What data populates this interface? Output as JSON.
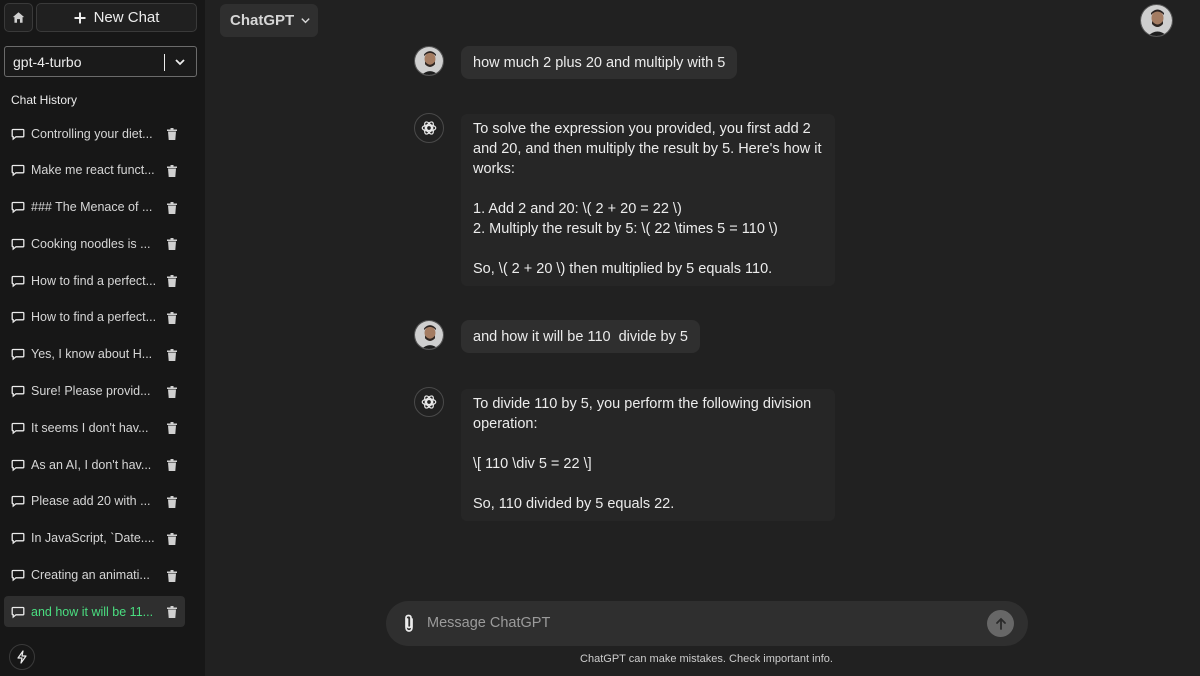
{
  "sidebar": {
    "new_chat_label": "New Chat",
    "model_select_value": "gpt-4-turbo",
    "history_title": "Chat History",
    "items": [
      {
        "label": "Controlling your diet..."
      },
      {
        "label": "Make me react funct..."
      },
      {
        "label": "### The Menace of ..."
      },
      {
        "label": "Cooking noodles is ..."
      },
      {
        "label": "How to find a perfect..."
      },
      {
        "label": "How to find a perfect..."
      },
      {
        "label": "Yes, I know about H..."
      },
      {
        "label": "Sure! Please provid..."
      },
      {
        "label": "It seems I don't hav..."
      },
      {
        "label": "As an AI, I don't hav..."
      },
      {
        "label": "Please add 20 with ..."
      },
      {
        "label": "In JavaScript, `Date...."
      },
      {
        "label": "Creating an animati..."
      },
      {
        "label": "and how it will be 11..."
      }
    ],
    "active_index": 13
  },
  "header": {
    "model_menu_label": "ChatGPT"
  },
  "messages": [
    {
      "role": "user",
      "text": "how much 2 plus 20 and multiply with 5"
    },
    {
      "role": "assistant",
      "text": "To solve the expression you provided, you first add 2\nand 20, and then multiply the result by 5. Here's how it\nworks:\n\n1. Add 2 and 20: \\( 2 + 20 = 22 \\)\n2. Multiply the result by 5: \\( 22 \\times 5 = 110 \\)\n\nSo, \\( 2 + 20 \\) then multiplied by 5 equals 110."
    },
    {
      "role": "user",
      "text": "and how it will be 110  divide by 5"
    },
    {
      "role": "assistant",
      "text": "To divide 110 by 5, you perform the following division\noperation:\n\n\\[ 110 \\div 5 = 22 \\]\n\nSo, 110 divided by 5 equals 22."
    }
  ],
  "composer": {
    "placeholder": "Message ChatGPT"
  },
  "disclaimer": "ChatGPT can make mistakes. Check important info.",
  "colors": {
    "background": "#212121",
    "sidebar": "#171717",
    "bubble": "#2f2f2f",
    "active_history": "#4ade80"
  }
}
